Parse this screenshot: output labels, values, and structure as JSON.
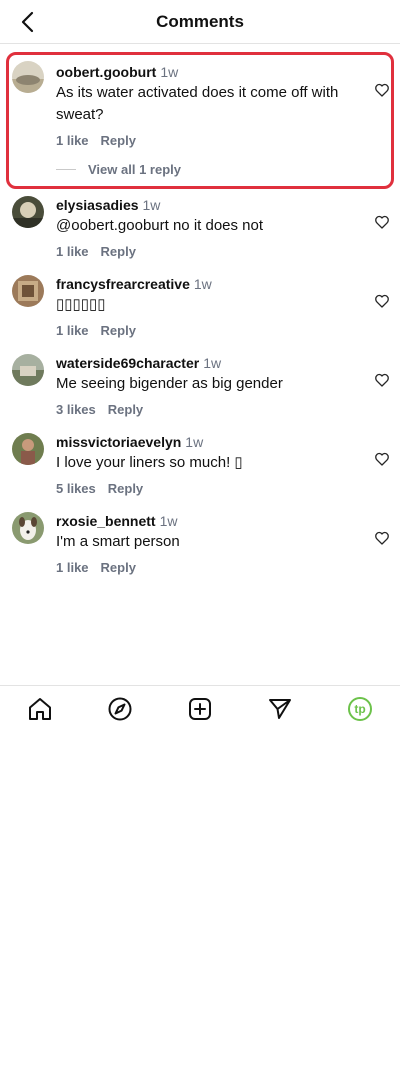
{
  "header": {
    "title": "Comments",
    "back_icon": "chevron-left-icon"
  },
  "comments": [
    {
      "username": "oobert.gooburt",
      "time": "1w",
      "text": "As its water activated does it come off with sweat?",
      "likes": "1 like",
      "reply": "Reply",
      "view_replies": "View all 1 reply"
    },
    {
      "username": "elysiasadies",
      "time": "1w",
      "text": "@oobert.gooburt no it does not",
      "likes": "1 like",
      "reply": "Reply"
    },
    {
      "username": "francysfrearcreative",
      "time": "1w",
      "text": "▯▯▯▯▯▯",
      "likes": "1 like",
      "reply": "Reply"
    },
    {
      "username": "waterside69character",
      "time": "1w",
      "text": "Me seeing bigender as big gender",
      "likes": "3 likes",
      "reply": "Reply"
    },
    {
      "username": "missvictoriaevelyn",
      "time": "1w",
      "text": "I love your liners so much! ▯",
      "likes": "5 likes",
      "reply": "Reply"
    },
    {
      "username": "rxosie_bennett",
      "time": "1w",
      "text": "I'm a smart person",
      "likes": "1 like",
      "reply": "Reply"
    }
  ],
  "bottom_nav": {
    "items": [
      "home-icon",
      "explore-compass-icon",
      "create-plus-icon",
      "send-icon",
      "profile-tp-icon"
    ],
    "profile_badge_text": "tp"
  },
  "colors": {
    "highlight": "#e0303d",
    "muted_text": "#6b7280",
    "profile_green": "#6cc24a"
  }
}
